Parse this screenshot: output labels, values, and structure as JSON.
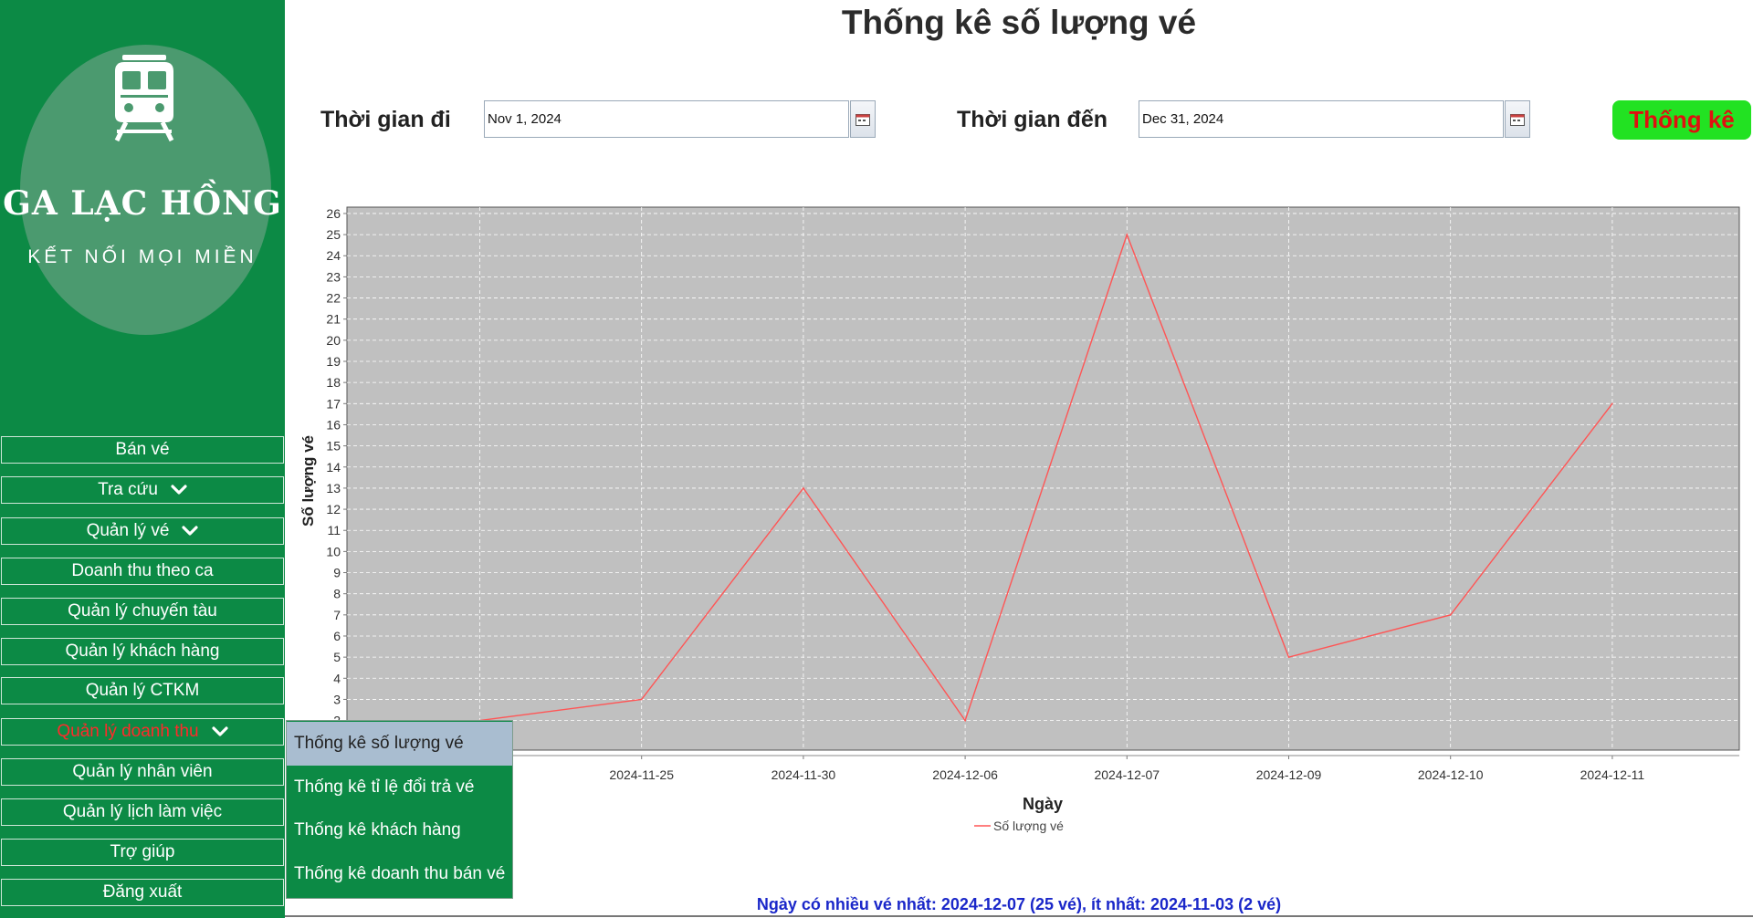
{
  "brand": {
    "name": "GA LẠC HỒNG",
    "slogan": "KẾT NỐI MỌI MIỀN"
  },
  "menu": [
    {
      "label": "Bán vé",
      "has_dropdown": false
    },
    {
      "label": "Tra cứu",
      "has_dropdown": true
    },
    {
      "label": "Quản lý vé",
      "has_dropdown": true
    },
    {
      "label": "Doanh thu theo ca",
      "has_dropdown": false
    },
    {
      "label": "Quản lý chuyến tàu",
      "has_dropdown": false
    },
    {
      "label": "Quản lý khách hàng",
      "has_dropdown": false
    },
    {
      "label": "Quản lý CTKM",
      "has_dropdown": false
    },
    {
      "label": "Quản lý doanh thu",
      "has_dropdown": true,
      "active": true
    },
    {
      "label": "Quản lý nhân viên",
      "has_dropdown": false
    },
    {
      "label": "Quản lý lịch làm việc",
      "has_dropdown": false
    },
    {
      "label": "Trợ giúp",
      "has_dropdown": false
    },
    {
      "label": "Đăng xuất",
      "has_dropdown": false
    }
  ],
  "dropdown": [
    {
      "label": "Thống kê số lượng vé",
      "selected": true
    },
    {
      "label": "Thống kê tỉ lệ đổi trả vé"
    },
    {
      "label": "Thống kê khách hàng"
    },
    {
      "label": "Thống kê doanh thu bán vé"
    }
  ],
  "page": {
    "title": "Thống kê số lượng vé"
  },
  "filters": {
    "from_label": "Thời gian đi",
    "from_value": "Nov 1, 2024",
    "to_label": "Thời gian đến",
    "to_value": "Dec 31, 2024",
    "submit_label": "Thống kê"
  },
  "footer": {
    "note": "Ngày có nhiều vé nhất: 2024-12-07 (25 vé), ít nhất: 2024-11-03 (2 vé)"
  },
  "colors": {
    "sidebar": "#0c8a45",
    "accent_button": "#22e222",
    "active_menu_text": "#ff2a2a",
    "plot_bg": "#c0c0c0",
    "series_line": "#ff5555",
    "footer_text": "#1a27c9"
  },
  "chart_data": {
    "type": "line",
    "categories": [
      "2024-11-03",
      "2024-11-25",
      "2024-11-30",
      "2024-12-06",
      "2024-12-07",
      "2024-12-09",
      "2024-12-10",
      "2024-12-11"
    ],
    "series": [
      {
        "name": "Số lượng vé",
        "values": [
          2,
          3,
          13,
          2,
          25,
          5,
          7,
          17
        ],
        "color": "#ff5555"
      }
    ],
    "xlabel": "Ngày",
    "ylabel": "Số lượng vé",
    "y_ticks": [
      "2",
      "3",
      "4",
      "5",
      "6",
      "7",
      "8",
      "9",
      "10",
      "11",
      "12",
      "13",
      "14",
      "15",
      "16",
      "17",
      "18",
      "19",
      "20",
      "21",
      "22",
      "23",
      "24",
      "25",
      "26"
    ],
    "ylim": [
      0.6,
      26.3
    ],
    "grid": true,
    "legend": "bottom-center"
  }
}
